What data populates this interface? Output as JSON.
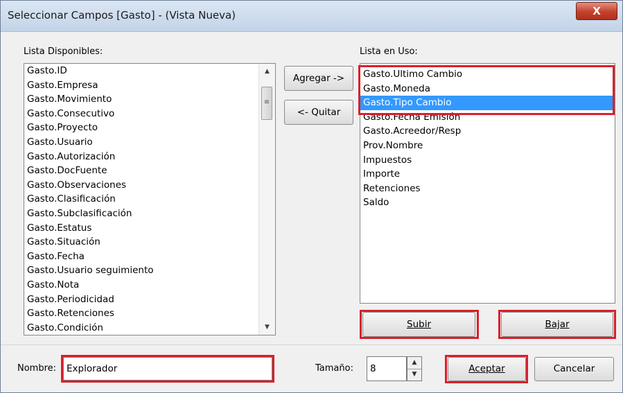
{
  "window": {
    "title": "Seleccionar Campos [Gasto] - (Vista Nueva)",
    "close_label": "X"
  },
  "available": {
    "label": "Lista Disponibles:",
    "items": [
      "Gasto.ID",
      "Gasto.Empresa",
      "Gasto.Movimiento",
      "Gasto.Consecutivo",
      "Gasto.Proyecto",
      "Gasto.Usuario",
      "Gasto.Autorización",
      "Gasto.DocFuente",
      "Gasto.Observaciones",
      "Gasto.Clasificación",
      "Gasto.Subclasificación",
      "Gasto.Estatus",
      "Gasto.Situación",
      "Gasto.Fecha",
      "Gasto.Usuario seguimiento",
      "Gasto.Nota",
      "Gasto.Periodicidad",
      "Gasto.Retenciones",
      "Gasto.Condición"
    ]
  },
  "buttons": {
    "add": "Agregar ->",
    "remove": "<- Quitar",
    "up": "Subir",
    "down": "Bajar",
    "accept": "Aceptar",
    "cancel": "Cancelar"
  },
  "inuse": {
    "label": "Lista en Uso:",
    "items": [
      "Gasto.Ultimo Cambio",
      "Gasto.Moneda",
      "Gasto.Tipo Cambio",
      "Gasto.Fecha Emisión",
      "Gasto.Acreedor/Resp",
      "Prov.Nombre",
      "Impuestos",
      "Importe",
      "Retenciones",
      "Saldo"
    ],
    "selected_index": 2
  },
  "name_field": {
    "label": "Nombre:",
    "value": "Explorador"
  },
  "size_field": {
    "label": "Tamaño:",
    "value": "8"
  },
  "colors": {
    "highlight": "#d9202a",
    "selection": "#3399ff"
  }
}
